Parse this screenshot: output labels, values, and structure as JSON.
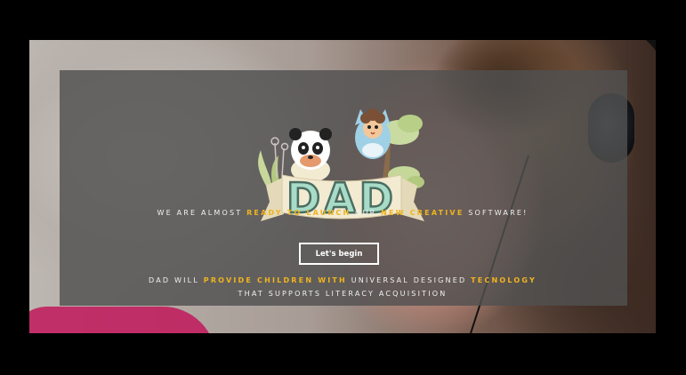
{
  "hero": {
    "logo_text": "DAD",
    "headline": {
      "part1": "WE ARE ALMOST ",
      "highlight1": "READY TO LAUNCH",
      "part2": " OUR ",
      "highlight2": "NEW CREATIVE",
      "part3": " SOFTWARE!"
    },
    "cta_label": "Let's begin",
    "tagline": {
      "part1": "DAD WILL ",
      "highlight1": "PROVIDE CHILDREN WITH",
      "part2": " UNIVERSAL DESIGNED ",
      "highlight2": "TECNOLOGY",
      "line2": "THAT SUPPORTS LITERACY ACQUISITION"
    }
  },
  "colors": {
    "accent": "#f0b41e",
    "overlay": "#505050",
    "text": "#f1f1f1",
    "page_background": "#000000",
    "logo_letters": "#a8dcc8",
    "banner": "#f3ead2"
  },
  "icons": [
    "panda-mascot-icon",
    "owl-mascot-icon",
    "tree-icon",
    "plant-icon"
  ]
}
